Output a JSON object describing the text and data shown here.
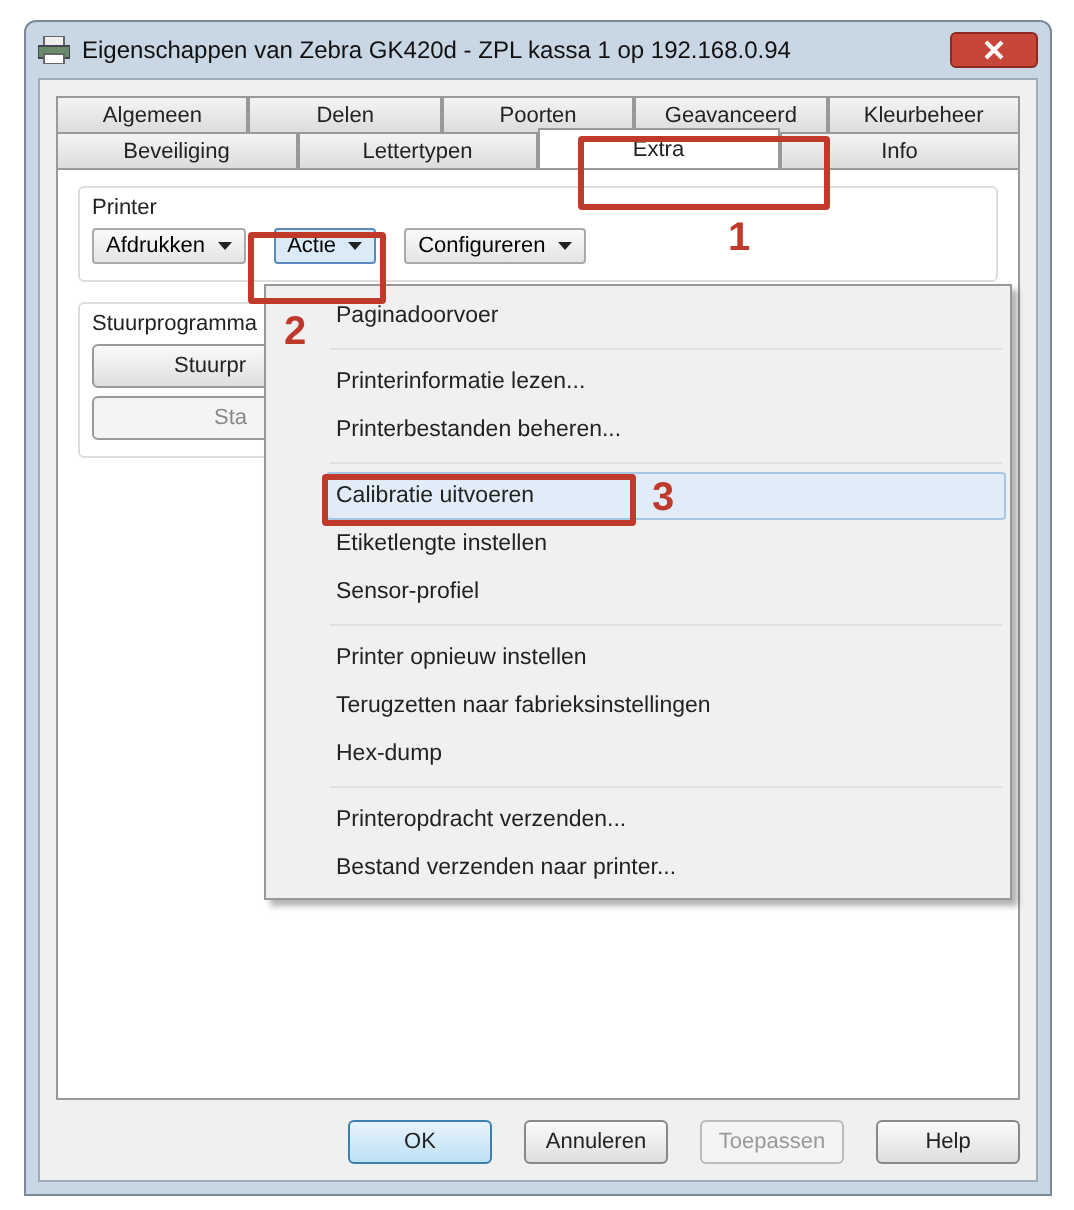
{
  "window": {
    "title": "Eigenschappen van Zebra GK420d - ZPL kassa 1 op 192.168.0.94"
  },
  "tab_rows": [
    [
      {
        "label": "Algemeen",
        "selected": false
      },
      {
        "label": "Delen",
        "selected": false
      },
      {
        "label": "Poorten",
        "selected": false
      },
      {
        "label": "Geavanceerd",
        "selected": false
      },
      {
        "label": "Kleurbeheer",
        "selected": false
      }
    ],
    [
      {
        "label": "Beveiliging",
        "selected": false
      },
      {
        "label": "Lettertypen",
        "selected": false
      },
      {
        "label": "Extra",
        "selected": true
      },
      {
        "label": "Info",
        "selected": false
      }
    ]
  ],
  "printer_group": {
    "label": "Printer",
    "buttons": [
      {
        "label": "Afdrukken",
        "open": false
      },
      {
        "label": "Actie",
        "open": true
      },
      {
        "label": "Configureren",
        "open": false
      }
    ]
  },
  "driver_group": {
    "label": "Stuurprogramma",
    "buttons": [
      "Stuurpr",
      "Sta"
    ]
  },
  "menu": {
    "items": [
      {
        "kind": "item",
        "label": "Paginadoorvoer",
        "selected": false
      },
      {
        "kind": "separator"
      },
      {
        "kind": "item",
        "label": "Printerinformatie lezen...",
        "selected": false
      },
      {
        "kind": "item",
        "label": "Printerbestanden beheren...",
        "selected": false
      },
      {
        "kind": "separator"
      },
      {
        "kind": "item",
        "label": "Calibratie uitvoeren",
        "selected": true
      },
      {
        "kind": "item",
        "label": "Etiketlengte instellen",
        "selected": false
      },
      {
        "kind": "item",
        "label": "Sensor-profiel",
        "selected": false
      },
      {
        "kind": "separator"
      },
      {
        "kind": "item",
        "label": "Printer opnieuw instellen",
        "selected": false
      },
      {
        "kind": "item",
        "label": "Terugzetten naar fabrieksinstellingen",
        "selected": false
      },
      {
        "kind": "item",
        "label": "Hex-dump",
        "selected": false
      },
      {
        "kind": "separator"
      },
      {
        "kind": "item",
        "label": "Printeropdracht verzenden...",
        "selected": false
      },
      {
        "kind": "item",
        "label": "Bestand verzenden naar printer...",
        "selected": false
      }
    ]
  },
  "annotations": [
    {
      "number": "1"
    },
    {
      "number": "2"
    },
    {
      "number": "3"
    }
  ],
  "dialog_buttons": [
    {
      "label": "OK",
      "default": true,
      "disabled": false
    },
    {
      "label": "Annuleren",
      "default": false,
      "disabled": false
    },
    {
      "label": "Toepassen",
      "default": false,
      "disabled": true
    },
    {
      "label": "Help",
      "default": false,
      "disabled": false
    }
  ]
}
